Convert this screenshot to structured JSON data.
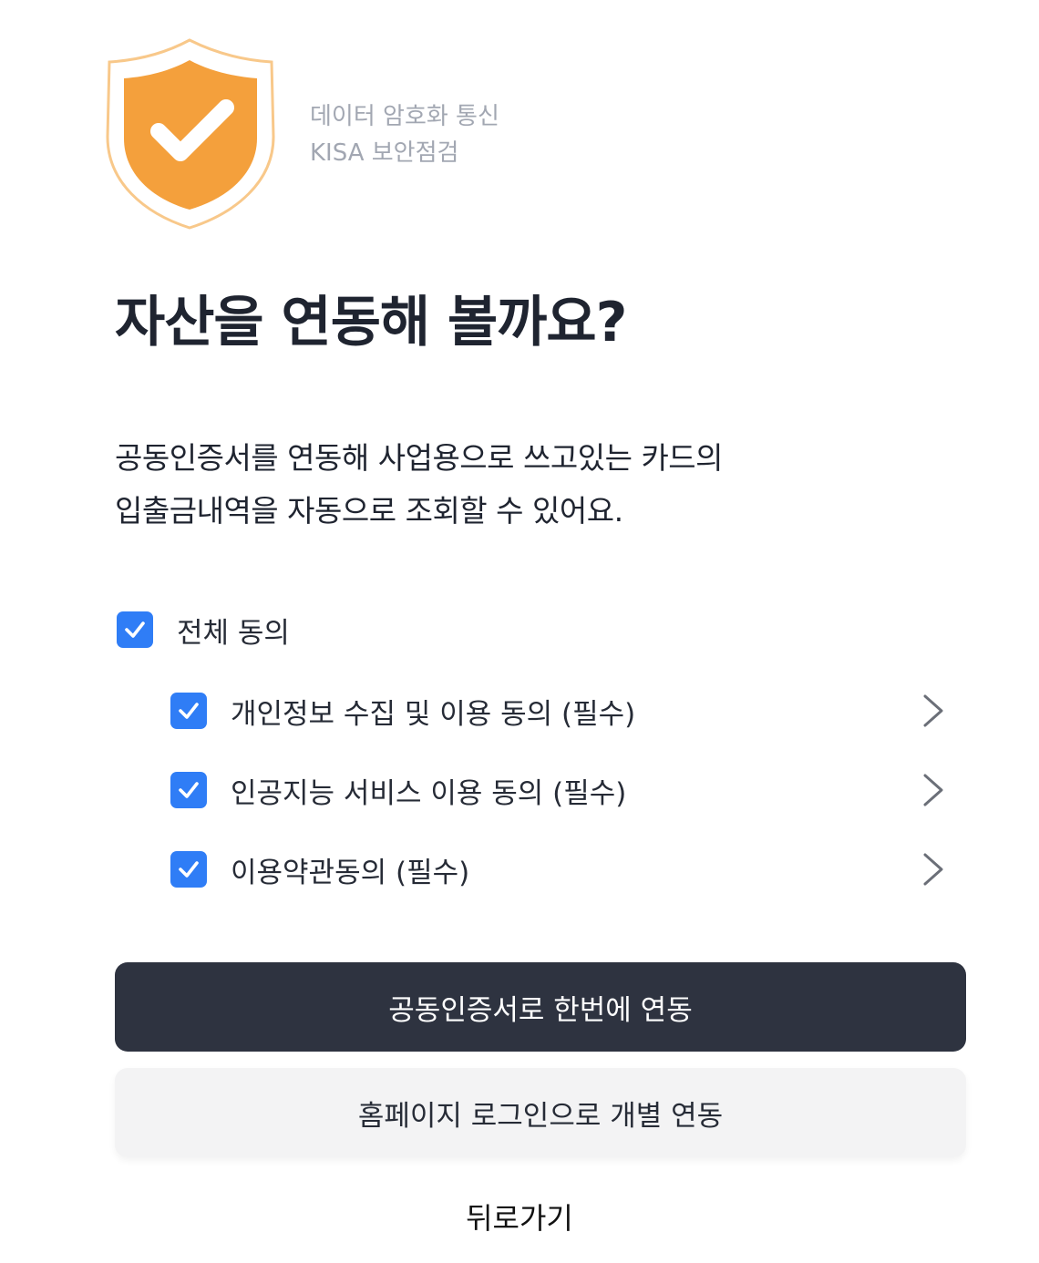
{
  "header": {
    "security_line1": "데이터 암호화 통신",
    "security_line2": "KISA 보안점검",
    "shield_icon": "shield-check-icon"
  },
  "title": "자산을 연동해 볼까요?",
  "description": {
    "line1": "공동인증서를 연동해 사업용으로 쓰고있는 카드의",
    "line2": "입출금내역을 자동으로 조회할 수 있어요."
  },
  "consent": {
    "all": {
      "label": "전체 동의",
      "checked": true
    },
    "items": [
      {
        "label": "개인정보 수집 및 이용 동의 (필수)",
        "checked": true
      },
      {
        "label": "인공지능 서비스 이용 동의 (필수)",
        "checked": true
      },
      {
        "label": "이용약관동의 (필수)",
        "checked": true
      }
    ]
  },
  "buttons": {
    "primary": "공동인증서로 한번에 연동",
    "secondary": "홈페이지 로그인으로 개별 연동",
    "back": "뒤로가기"
  },
  "colors": {
    "shield_orange": "#f4a03c",
    "shield_outline": "#f8c88a",
    "checkbox_blue": "#2f7df6",
    "primary_button": "#2e3340",
    "secondary_button": "#f3f3f4",
    "caption_gray": "#a2a7b2"
  }
}
